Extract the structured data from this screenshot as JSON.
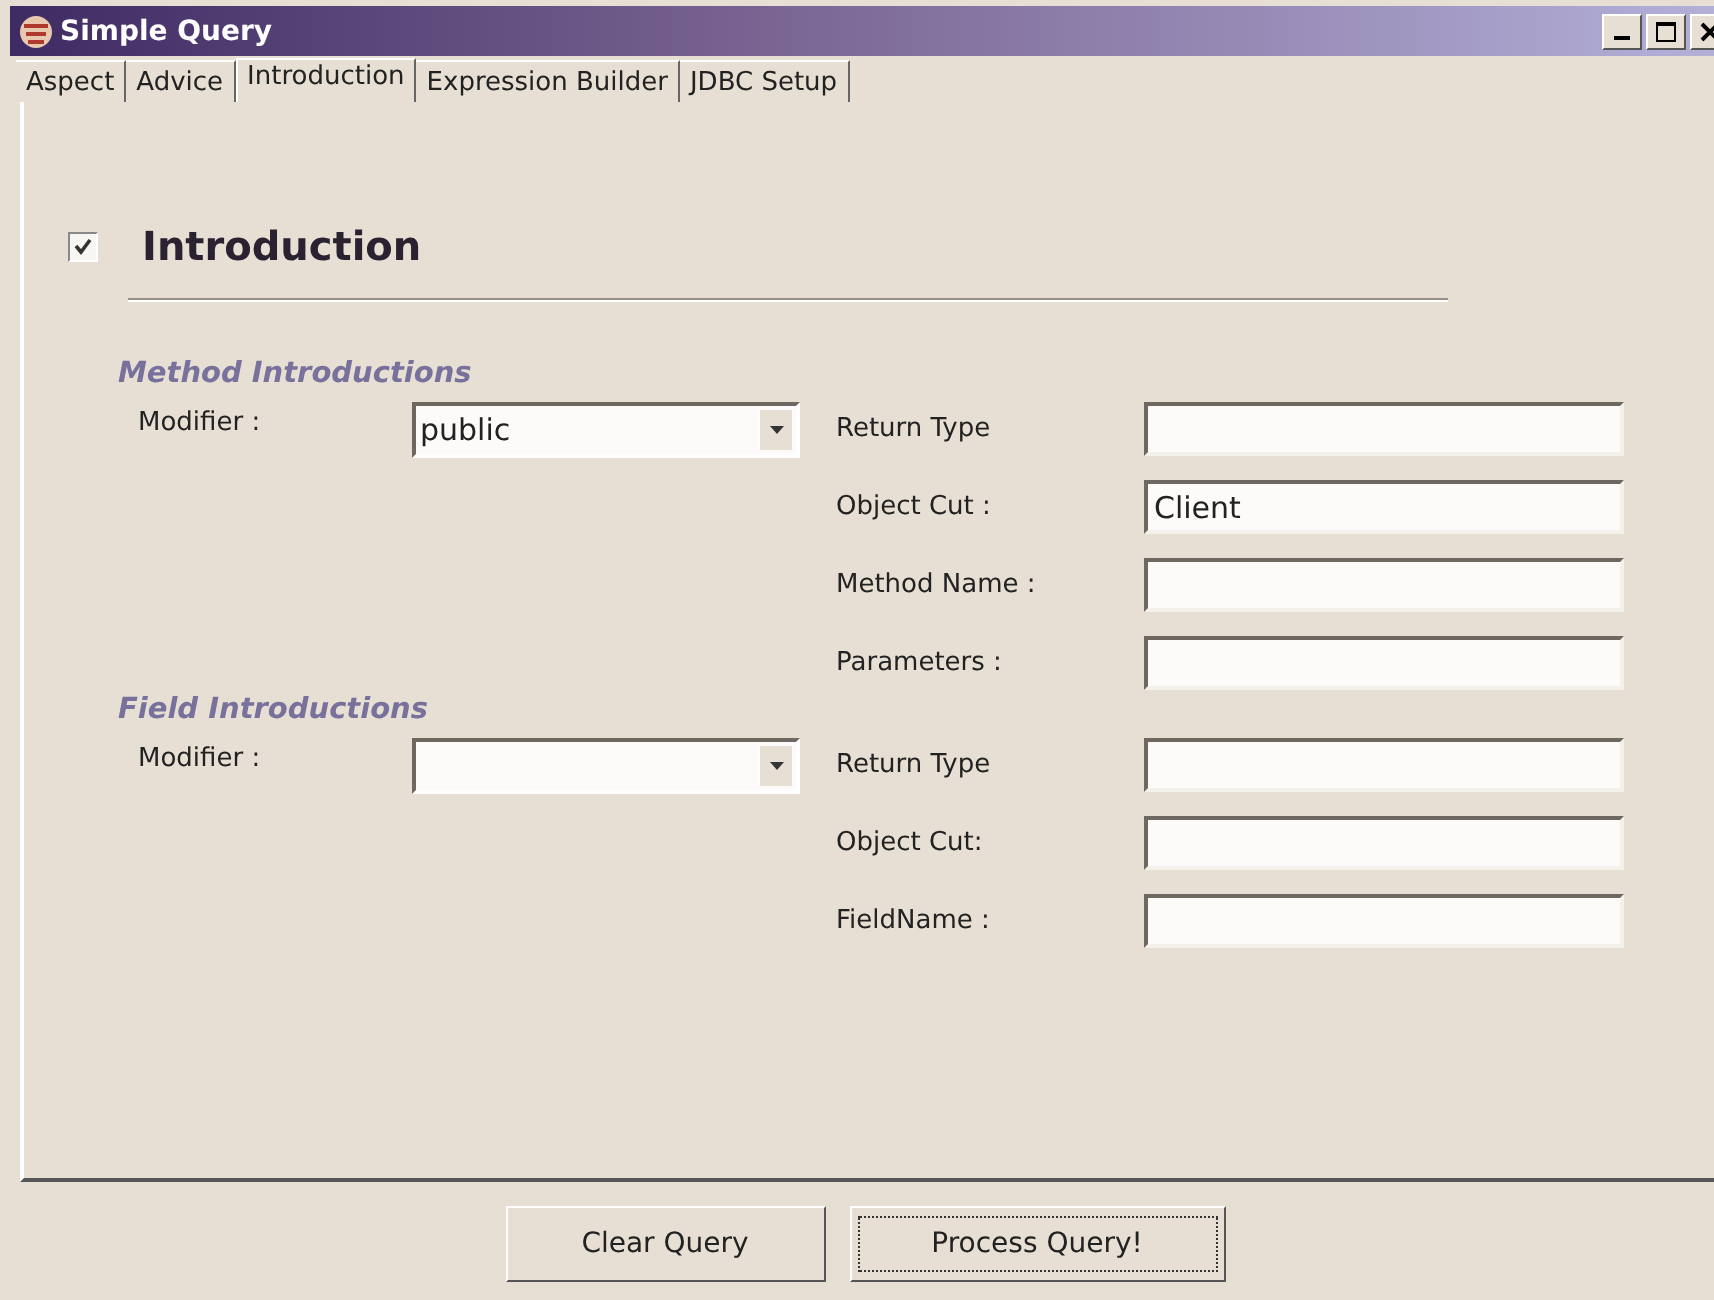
{
  "window": {
    "title": "Simple Query"
  },
  "tabs": [
    {
      "label": "Aspect",
      "selected": false
    },
    {
      "label": "Advice",
      "selected": false
    },
    {
      "label": "Introduction",
      "selected": true
    },
    {
      "label": "Expression Builder",
      "selected": false
    },
    {
      "label": "JDBC Setup",
      "selected": false
    }
  ],
  "header": {
    "label": "Introduction",
    "checked": true
  },
  "sections": [
    {
      "heading": "Method Introductions",
      "modifier": {
        "label": "Modifier :",
        "value": "public"
      },
      "fields": [
        {
          "label": "Return Type"
        },
        {
          "label": "Object Cut :",
          "value": "Client"
        },
        {
          "label": "Method Name :"
        },
        {
          "label": "Parameters :"
        }
      ]
    },
    {
      "heading": "Field Introductions",
      "modifier": {
        "label": "Modifier :"
      },
      "fields": [
        {
          "label": "Return Type"
        },
        {
          "label": "Object Cut:"
        },
        {
          "label": "FieldName :"
        }
      ]
    }
  ],
  "buttons": [
    {
      "label": "Clear Query",
      "focused": false
    },
    {
      "label": "Process Query!",
      "focused": true
    }
  ]
}
